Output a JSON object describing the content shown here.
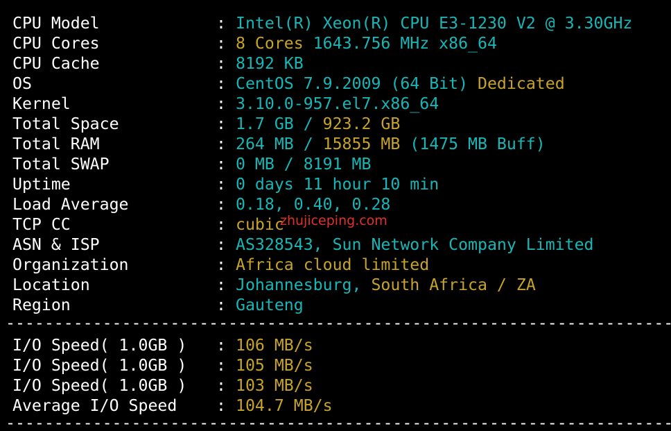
{
  "colors": {
    "background": "#000000",
    "label": "#ffffff",
    "cyan": "#18b6b6",
    "yellow": "#c8a32a",
    "watermark": "#e0322a"
  },
  "separator": ":",
  "divider_text": "----------------------------------------------------------------------",
  "info_rows": [
    {
      "label": "CPU Model",
      "parts": [
        {
          "text": "Intel(R) Xeon(R) CPU E3-1230 V2 @ 3.30GHz",
          "color": "cyan"
        }
      ]
    },
    {
      "label": "CPU Cores",
      "parts": [
        {
          "text": "8 Cores ",
          "color": "yellow"
        },
        {
          "text": "1643.756 MHz x86_64",
          "color": "cyan"
        }
      ]
    },
    {
      "label": "CPU Cache",
      "parts": [
        {
          "text": "8192 KB",
          "color": "cyan"
        }
      ]
    },
    {
      "label": "OS",
      "parts": [
        {
          "text": "CentOS 7.9.2009 (64 Bit) ",
          "color": "cyan"
        },
        {
          "text": "Dedicated",
          "color": "yellow"
        }
      ]
    },
    {
      "label": "Kernel",
      "parts": [
        {
          "text": "3.10.0-957.el7.x86_64",
          "color": "cyan"
        }
      ]
    },
    {
      "label": "Total Space",
      "parts": [
        {
          "text": "1.7 GB / ",
          "color": "cyan"
        },
        {
          "text": "923.2 GB",
          "color": "yellow"
        }
      ]
    },
    {
      "label": "Total RAM",
      "parts": [
        {
          "text": "264 MB / ",
          "color": "cyan"
        },
        {
          "text": "15855 MB ",
          "color": "yellow"
        },
        {
          "text": "(1475 MB Buff)",
          "color": "cyan"
        }
      ]
    },
    {
      "label": "Total SWAP",
      "parts": [
        {
          "text": "0 MB / 8191 MB",
          "color": "cyan"
        }
      ]
    },
    {
      "label": "Uptime",
      "parts": [
        {
          "text": "0 days 11 hour 10 min",
          "color": "cyan"
        }
      ]
    },
    {
      "label": "Load Average",
      "parts": [
        {
          "text": "0.18, 0.40, 0.28",
          "color": "cyan"
        }
      ]
    },
    {
      "label": "TCP CC",
      "parts": [
        {
          "text": "cubic",
          "color": "yellow"
        }
      ]
    },
    {
      "label": "ASN & ISP",
      "parts": [
        {
          "text": "AS328543, Sun Network Company Limited",
          "color": "cyan"
        }
      ]
    },
    {
      "label": "Organization",
      "parts": [
        {
          "text": "Africa cloud limited",
          "color": "yellow"
        }
      ]
    },
    {
      "label": "Location",
      "parts": [
        {
          "text": "Johannesburg, ",
          "color": "cyan"
        },
        {
          "text": "South Africa / ZA",
          "color": "yellow"
        }
      ]
    },
    {
      "label": "Region",
      "parts": [
        {
          "text": "Gauteng",
          "color": "cyan"
        }
      ]
    }
  ],
  "io_rows": [
    {
      "label": "I/O Speed( 1.0GB )",
      "parts": [
        {
          "text": "106 MB/s",
          "color": "yellow"
        }
      ]
    },
    {
      "label": "I/O Speed( 1.0GB )",
      "parts": [
        {
          "text": "105 MB/s",
          "color": "yellow"
        }
      ]
    },
    {
      "label": "I/O Speed( 1.0GB )",
      "parts": [
        {
          "text": "103 MB/s",
          "color": "yellow"
        }
      ]
    },
    {
      "label": "Average I/O Speed",
      "parts": [
        {
          "text": "104.7 MB/s",
          "color": "yellow"
        }
      ]
    }
  ],
  "watermark": "zhujiceping.com"
}
